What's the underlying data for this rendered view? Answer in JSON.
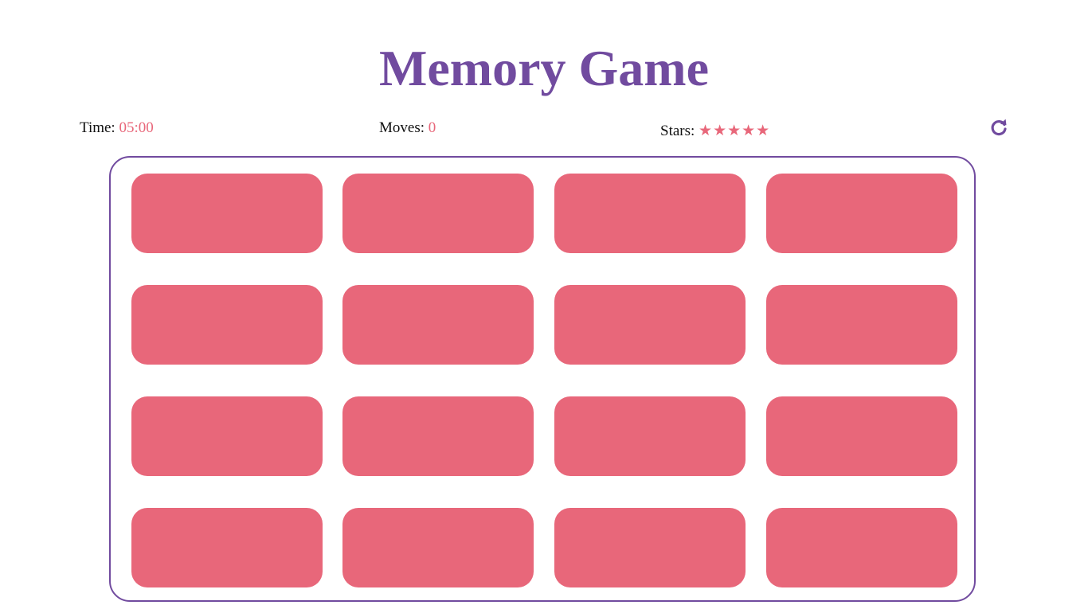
{
  "header": {
    "title": "Memory Game"
  },
  "stats": {
    "time_label": "Time:",
    "time_value": "05:00",
    "moves_label": "Moves:",
    "moves_value": "0",
    "stars_label": "Stars:",
    "stars_value": "★★★★★",
    "stars_count": 5
  },
  "controls": {
    "restart_icon": "restart-icon"
  },
  "board": {
    "rows": 4,
    "columns": 4,
    "cards_face_down": 16
  },
  "colors": {
    "accent": "#714b9f",
    "card_back": "#e8677a",
    "stat_value": "#e8677a"
  }
}
